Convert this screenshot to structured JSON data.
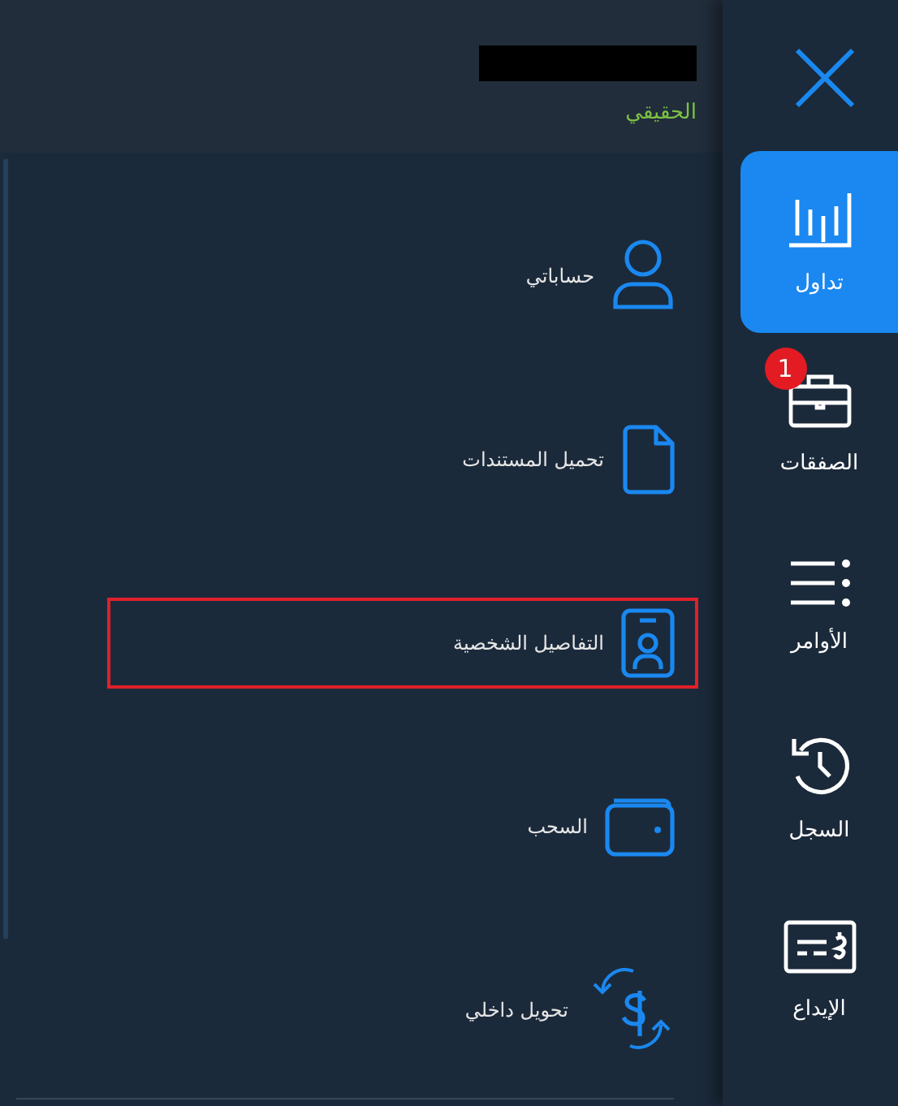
{
  "header": {
    "account_type": "الحقيقي"
  },
  "menu": [
    {
      "kind": "user",
      "label": "حساباتي",
      "highlighted": false
    },
    {
      "kind": "document",
      "label": "تحميل المستندات",
      "highlighted": false
    },
    {
      "kind": "badge",
      "label": "التفاصيل الشخصية",
      "highlighted": true
    },
    {
      "kind": "wallet",
      "label": "السحب",
      "highlighted": false
    },
    {
      "kind": "transfer",
      "label": "تحويل داخلي",
      "highlighted": false
    }
  ],
  "rail": [
    {
      "kind": "chart",
      "label": "تداول",
      "selected": true
    },
    {
      "kind": "briefcase",
      "label": "الصفقات",
      "selected": false,
      "badge": "1"
    },
    {
      "kind": "list",
      "label": "الأوامر",
      "selected": false
    },
    {
      "kind": "history",
      "label": "السجل",
      "selected": false
    },
    {
      "kind": "deposit",
      "label": "الإيداع",
      "selected": false
    }
  ]
}
